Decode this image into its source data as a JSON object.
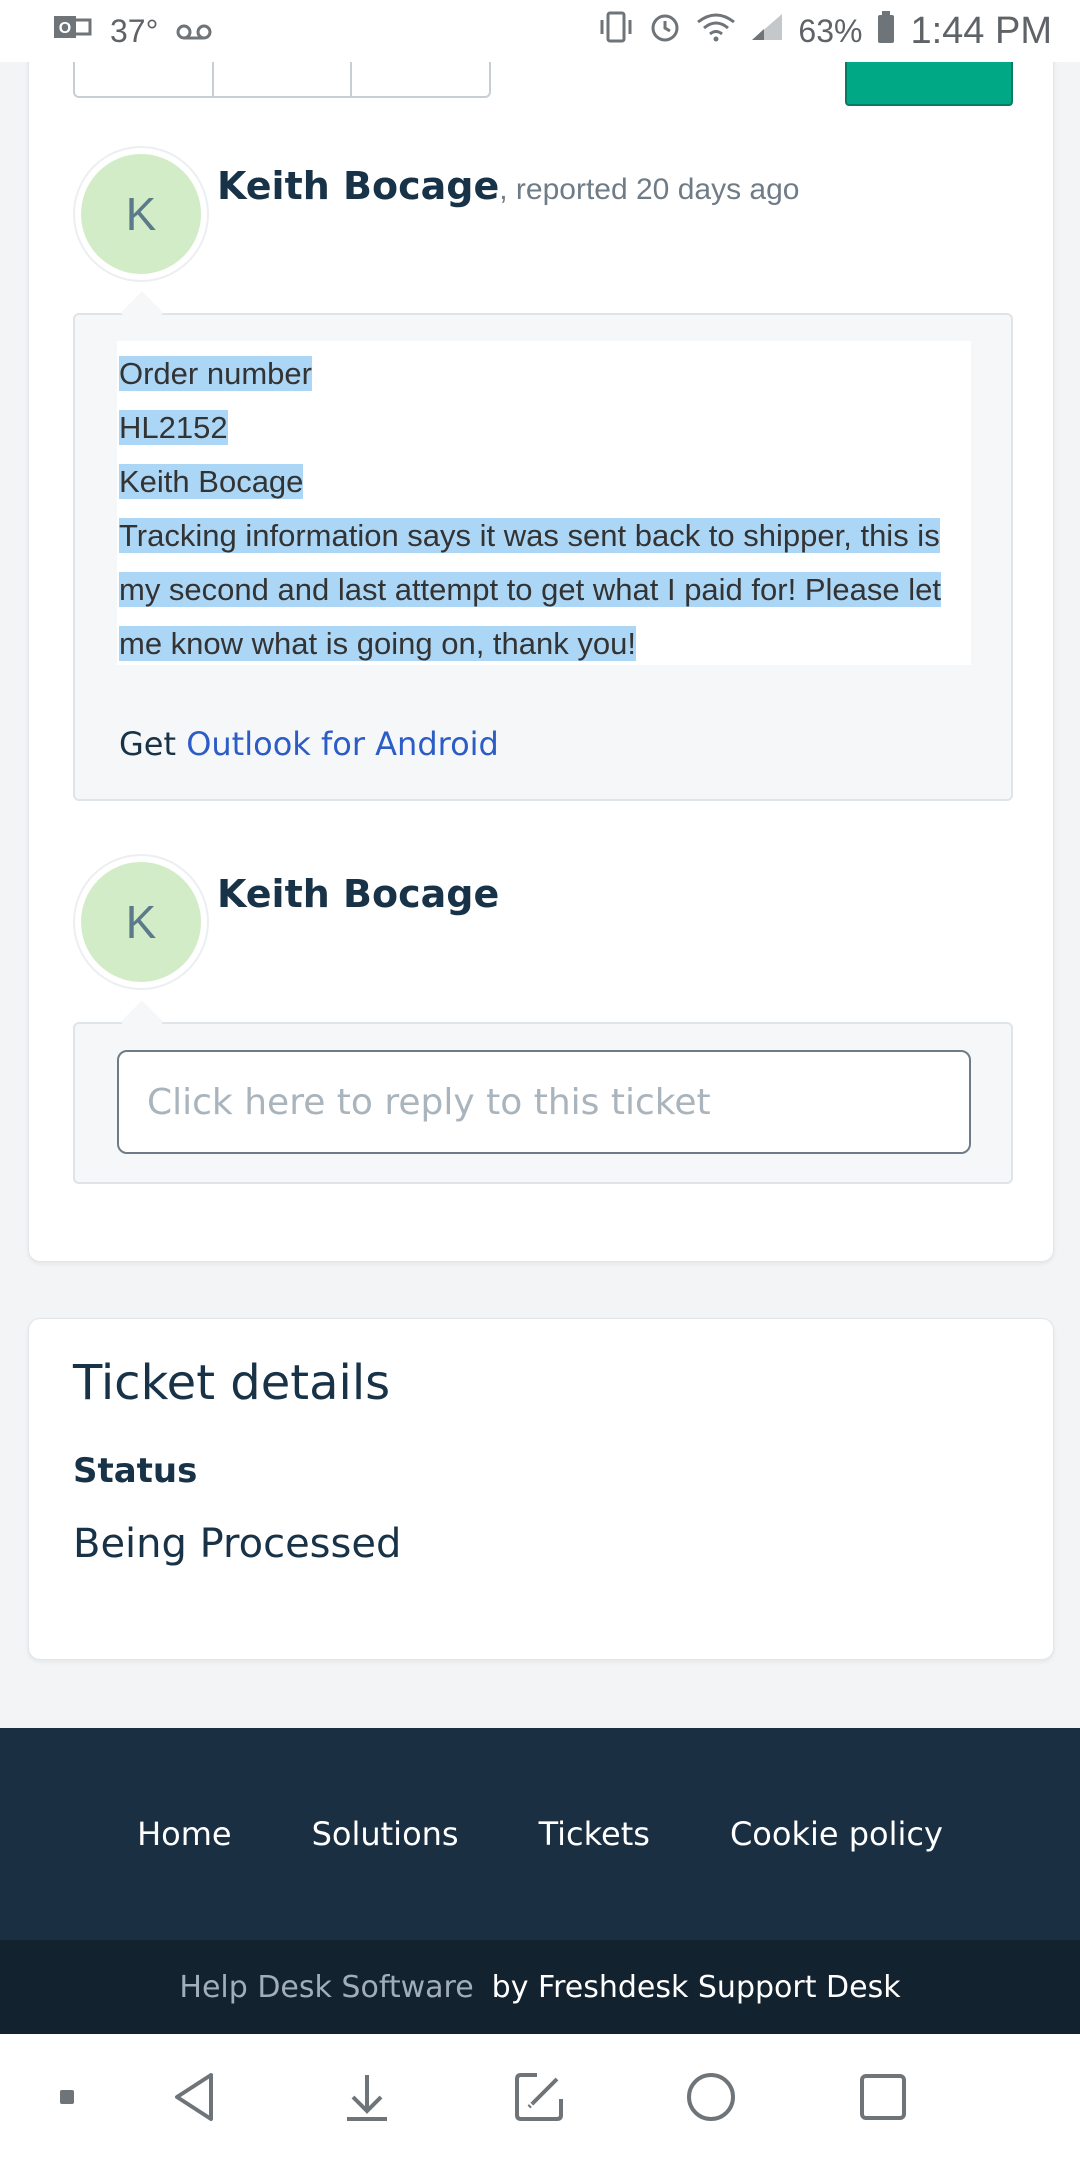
{
  "status_bar": {
    "temperature": "37°",
    "battery": "63%",
    "time": "1:44 PM"
  },
  "conversation": {
    "message": {
      "avatar_initial": "K",
      "author": "Keith Bocage",
      "meta": ", reported 20 days ago",
      "lines": [
        "Order number",
        "HL2152",
        "Keith Bocage",
        "Tracking information says it was sent back to shipper, this is",
        "my second and last attempt to get what I paid for! Please let",
        "me know what is going on, thank you!"
      ],
      "footer_prefix": "Get ",
      "footer_link": "Outlook for Android"
    },
    "reply": {
      "avatar_initial": "K",
      "author": "Keith Bocage",
      "placeholder": "Click here to reply to this ticket"
    }
  },
  "ticket_details": {
    "title": "Ticket details",
    "status_label": "Status",
    "status_value": "Being Processed"
  },
  "footer": {
    "links": [
      "Home",
      "Solutions",
      "Tickets",
      "Cookie policy"
    ],
    "powered_dim": "Help Desk Software",
    "powered_bright": "by Freshdesk Support Desk"
  },
  "icons": {
    "toolbar": [
      "reply-icon",
      "clock-icon",
      "add-person-icon"
    ],
    "green_button": "gear-icon",
    "navbar": [
      "dot-icon",
      "back-icon",
      "download-icon",
      "edit-icon",
      "home-icon",
      "recents-icon"
    ]
  }
}
